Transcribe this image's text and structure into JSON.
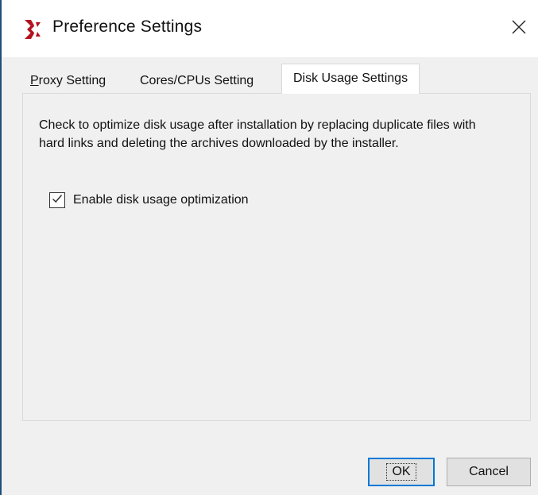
{
  "window": {
    "title": "Preference Settings",
    "app_icon": "xilinx-logo-icon",
    "close_icon": "close-icon",
    "accent_color": "#b3121f"
  },
  "tabs": [
    {
      "label_mnemonic": "P",
      "label_rest": "roxy Setting",
      "active": false
    },
    {
      "label": "Cores/CPUs Setting",
      "active": false
    },
    {
      "label": "Disk Usage Settings",
      "active": true
    }
  ],
  "panel": {
    "description": "Check to optimize disk usage after installation by replacing duplicate files with hard links and deleting the archives downloaded by the installer.",
    "checkbox": {
      "label": "Enable disk usage optimization",
      "checked": true,
      "icon": "checkmark-icon"
    }
  },
  "buttons": {
    "ok_label": "OK",
    "cancel_label": "Cancel"
  }
}
